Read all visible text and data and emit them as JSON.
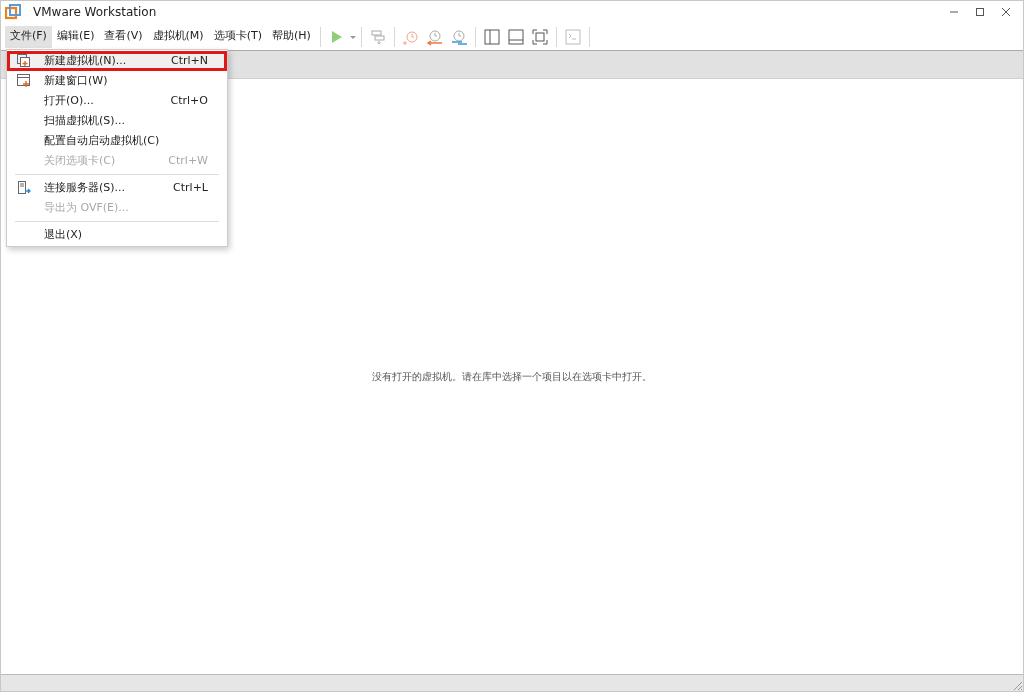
{
  "window": {
    "title": "VMware Workstation"
  },
  "menubar": [
    {
      "label": "文件(F)",
      "selected": true
    },
    {
      "label": "编辑(E)",
      "selected": false
    },
    {
      "label": "查看(V)",
      "selected": false
    },
    {
      "label": "虚拟机(M)",
      "selected": false
    },
    {
      "label": "选项卡(T)",
      "selected": false
    },
    {
      "label": "帮助(H)",
      "selected": false
    }
  ],
  "file_menu": [
    {
      "kind": "create",
      "label": "新建虚拟机(N)...",
      "shortcut": "Ctrl+N",
      "disabled": false,
      "highlighted": true
    },
    {
      "kind": "window",
      "label": "新建窗口(W)",
      "disabled": false,
      "highlighted": false
    },
    {
      "kind": "item",
      "label": "打开(O)...",
      "shortcut": "Ctrl+O",
      "disabled": false,
      "highlighted": false
    },
    {
      "kind": "item",
      "label": "扫描虚拟机(S)...",
      "disabled": false,
      "highlighted": false
    },
    {
      "kind": "item",
      "label": "配置自动启动虚拟机(C)",
      "disabled": false,
      "highlighted": false
    },
    {
      "kind": "item",
      "label": "关闭选项卡(C)",
      "shortcut": "Ctrl+W",
      "disabled": true,
      "highlighted": false
    },
    {
      "kind": "separator"
    },
    {
      "kind": "connect",
      "label": "连接服务器(S)...",
      "shortcut": "Ctrl+L",
      "disabled": false,
      "highlighted": false
    },
    {
      "kind": "item",
      "label": "导出为 OVF(E)...",
      "disabled": true,
      "highlighted": false
    },
    {
      "kind": "separator"
    },
    {
      "kind": "item",
      "label": "退出(X)",
      "disabled": false,
      "highlighted": false
    }
  ],
  "empty_message": "没有打开的虚拟机。请在库中选择一个项目以在选项卡中打开。"
}
